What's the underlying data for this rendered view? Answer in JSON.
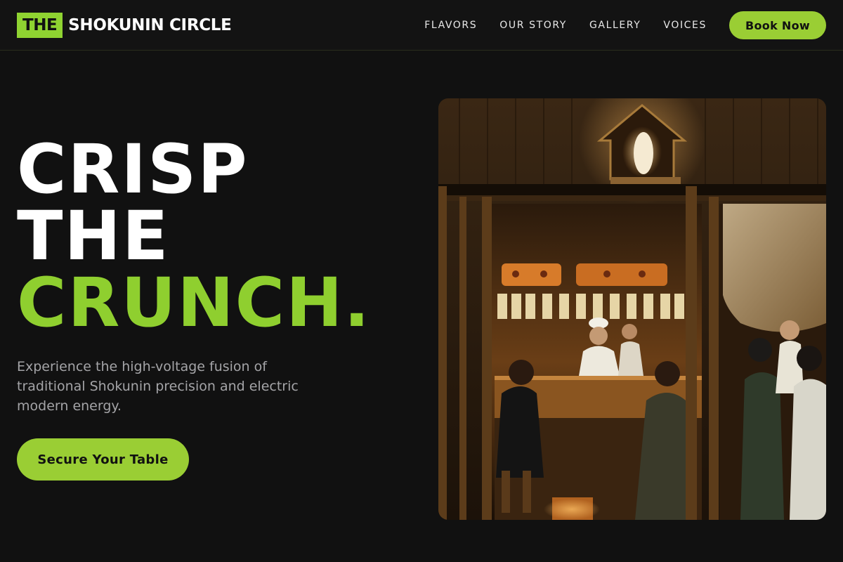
{
  "brand": {
    "mark": "THE",
    "name": "SHOKUNIN CIRCLE"
  },
  "nav": {
    "links": [
      {
        "label": "FLAVORS"
      },
      {
        "label": "OUR STORY"
      },
      {
        "label": "GALLERY"
      },
      {
        "label": "VOICES"
      }
    ],
    "cta_label": "Book Now"
  },
  "hero": {
    "title_line1": "CRISP",
    "title_line2": "THE",
    "title_line3": "CRUNCH.",
    "subtitle": "Experience the high-voltage fusion of traditional Shokunin precision and electric modern energy.",
    "cta_label": "Secure Your Table",
    "image_alt": "Diners and chefs at a warmly lit traditional Japanese izakaya counter"
  },
  "colors": {
    "background": "#111111",
    "accent": "#9ace34",
    "text": "#ffffff",
    "muted_text": "#a4a4a7"
  }
}
